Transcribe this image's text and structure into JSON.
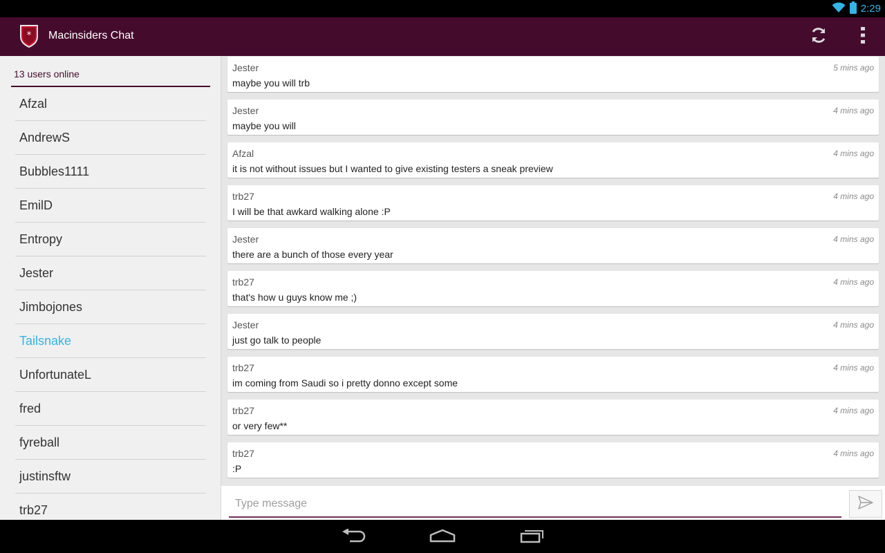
{
  "status_bar": {
    "time": "2:29",
    "icons": [
      "wifi-icon",
      "battery-icon"
    ]
  },
  "app_bar": {
    "title": "Macinsiders Chat",
    "logo_icon": "shield-icon",
    "actions": [
      "refresh-icon",
      "overflow-menu-icon"
    ]
  },
  "sidebar": {
    "header": "13 users online",
    "users": [
      {
        "name": "Afzal"
      },
      {
        "name": "AndrewS"
      },
      {
        "name": "Bubbles1111"
      },
      {
        "name": "EmilD"
      },
      {
        "name": "Entropy"
      },
      {
        "name": "Jester"
      },
      {
        "name": "Jimbojones"
      },
      {
        "name": "Tailsnake",
        "highlighted": true
      },
      {
        "name": "UnfortunateL"
      },
      {
        "name": "fred"
      },
      {
        "name": "fyreball"
      },
      {
        "name": "justinsftw"
      },
      {
        "name": "trb27"
      }
    ]
  },
  "messages": [
    {
      "user": "Jester",
      "time": "5 mins ago",
      "text": "maybe you will trb"
    },
    {
      "user": "Jester",
      "time": "4 mins ago",
      "text": "maybe you will"
    },
    {
      "user": "Afzal",
      "time": "4 mins ago",
      "text": "it is not without issues but I wanted to give existing testers a sneak preview"
    },
    {
      "user": "trb27",
      "time": "4 mins ago",
      "text": "I will be that awkard walking alone :P"
    },
    {
      "user": "Jester",
      "time": "4 mins ago",
      "text": "there are a bunch of those every year"
    },
    {
      "user": "trb27",
      "time": "4 mins ago",
      "text": "that's how u guys know me ;)"
    },
    {
      "user": "Jester",
      "time": "4 mins ago",
      "text": "just go talk to people"
    },
    {
      "user": "trb27",
      "time": "4 mins ago",
      "text": "im coming from Saudi so i pretty donno except some"
    },
    {
      "user": "trb27",
      "time": "4 mins ago",
      "text": "or very few**"
    },
    {
      "user": "trb27",
      "time": "4 mins ago",
      "text": ":P"
    }
  ],
  "composer": {
    "placeholder": "Type message",
    "value": ""
  },
  "nav_bar": {
    "buttons": [
      "back-icon",
      "home-icon",
      "recent-apps-icon"
    ]
  },
  "colors": {
    "primary": "#450b2d",
    "accent": "#33b5e5",
    "list_bg": "#f0f0f0",
    "chat_bg": "#e6e6e6"
  }
}
